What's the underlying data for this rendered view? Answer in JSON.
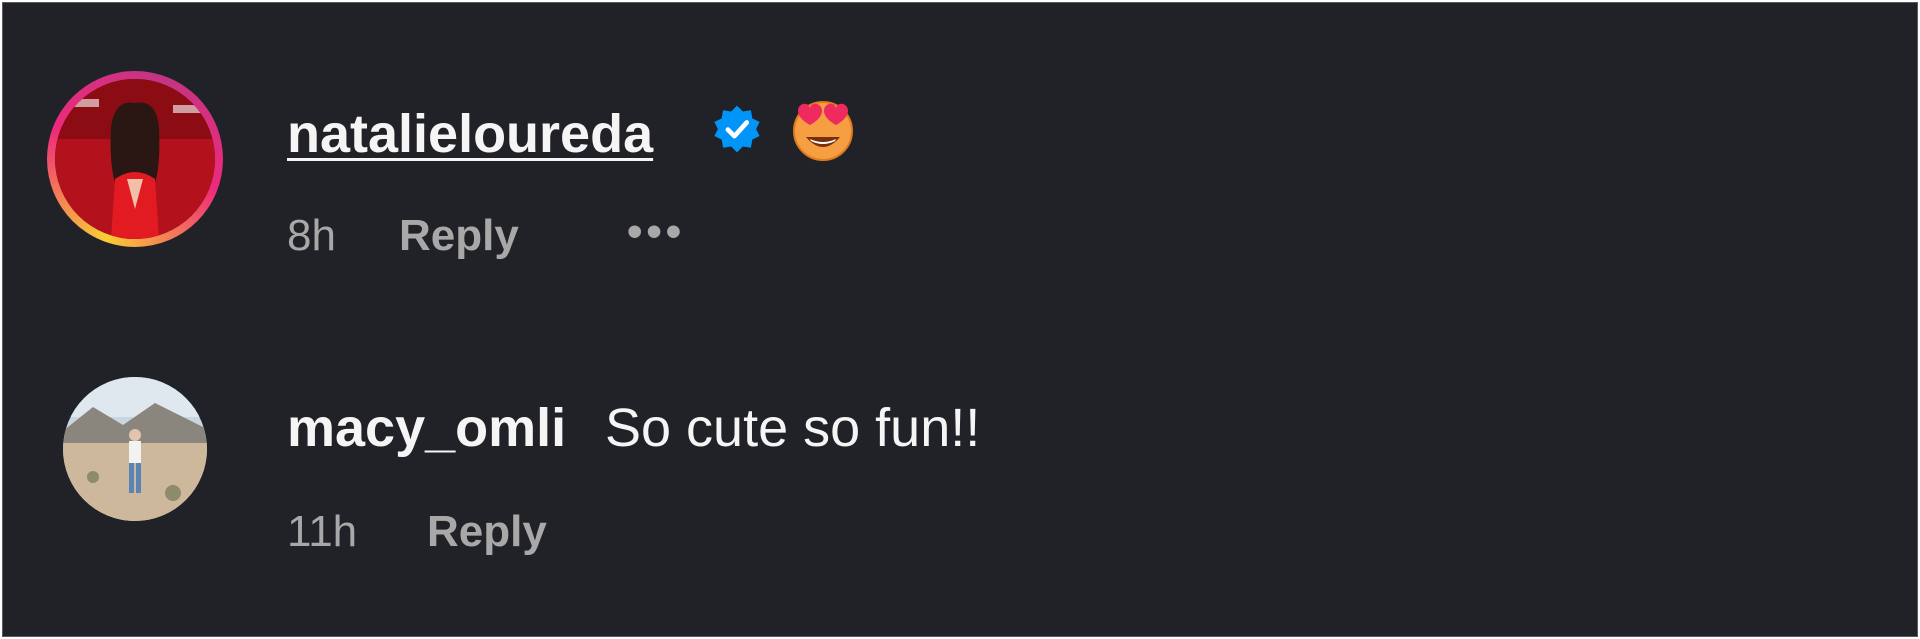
{
  "comments": [
    {
      "username": "natalieloureda",
      "verified": true,
      "text_emoji": "😍",
      "timestamp": "8h",
      "reply_label": "Reply",
      "more_label": "•••"
    },
    {
      "username": "macy_omli",
      "verified": false,
      "text": "So cute so fun!!",
      "timestamp": "11h",
      "reply_label": "Reply"
    }
  ],
  "colors": {
    "background": "#212227",
    "text_primary": "#f5f5f5",
    "text_secondary": "#a8a8a8",
    "verified_badge": "#0095f6"
  }
}
